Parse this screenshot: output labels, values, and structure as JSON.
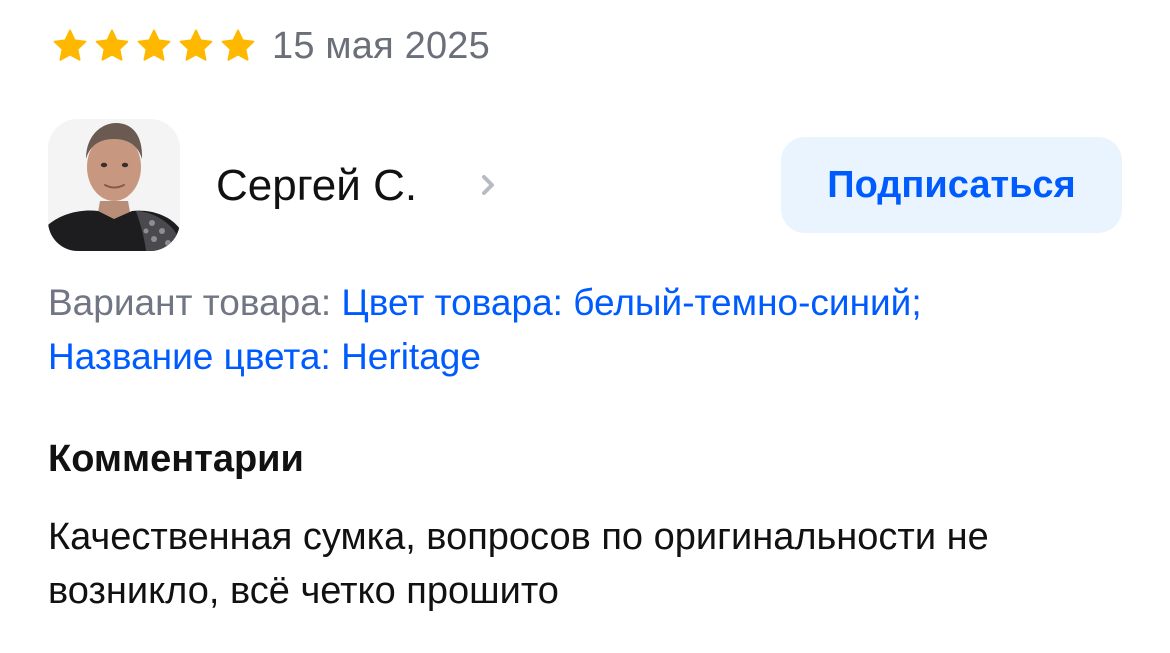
{
  "review": {
    "rating": {
      "value": 5,
      "max": 5,
      "star_color": "#ffb800",
      "star_icon": "star-icon"
    },
    "date": "15 мая 2025",
    "author": {
      "name": "Сергей С.",
      "avatar_icon": "user-avatar",
      "chevron_icon": "chevron-right-icon"
    },
    "subscribe_label": "Подписаться",
    "variant": {
      "label": "Вариант товара:",
      "value_line1": "Цвет товара: белый-темно-синий;",
      "value_line2": "Название цвета: Heritage"
    },
    "comments": {
      "heading": "Комментарии",
      "text": "Качественная сумка, вопросов по оригинальности не возникло, всё четко прошито"
    },
    "colors": {
      "accent": "#005bff",
      "button_bg": "#e9f4fe",
      "muted_text": "#707683",
      "text": "#111111"
    }
  }
}
